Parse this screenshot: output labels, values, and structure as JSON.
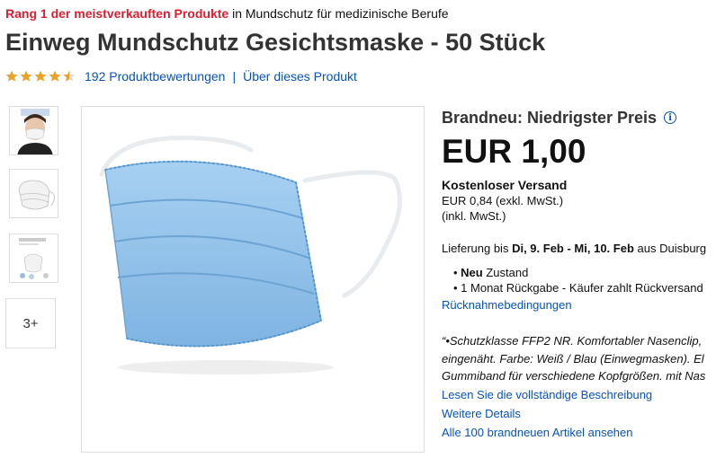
{
  "rank": {
    "highlight": "Rang 1 der meistverkauften Produkte",
    "rest": "in Mundschutz für medizinische Berufe"
  },
  "title": "Einweg Mundschutz Gesichtsmaske - 50 Stück",
  "rating": {
    "value": 4.5,
    "max": 5,
    "count_text": "192 Produktbewertungen",
    "about_link": "Über dieses Produkt",
    "star_color": "#e8a32b"
  },
  "thumbnails": {
    "more_label": "3+"
  },
  "purchase": {
    "condition_title": "Brandneu: Niedrigster Preis",
    "price": "EUR 1,00",
    "shipping": "Kostenloser Versand",
    "net_price": "EUR 0,84 (exkl. MwSt.)",
    "vat_note": "(inkl. MwSt.)",
    "delivery_prefix": "Lieferung bis",
    "delivery_dates": "Di, 9. Feb - Mi, 10. Feb",
    "delivery_suffix": "aus Duisburg",
    "condition_bold": "Neu",
    "condition_rest": "Zustand",
    "returns": "1 Monat Rückgabe - Käufer zahlt Rückversand",
    "returns_link": "Rücknahmebedingungen",
    "description": [
      "“•Schutzklasse FFP2 NR. Komfortabler Nasenclip,",
      "eingenäht. Farbe: Weiß / Blau (Einwegmasken). El",
      "Gummiband für verschiedene Kopfgrößen. mit Nas"
    ],
    "links": [
      "Lesen Sie die vollständige Beschreibung",
      "Weitere Details",
      "Alle 100 brandneuen Artikel ansehen"
    ]
  },
  "colors": {
    "rank_red": "#dd1e31",
    "link_blue": "#0654ba",
    "mask_blue": "#8fc0ea"
  }
}
